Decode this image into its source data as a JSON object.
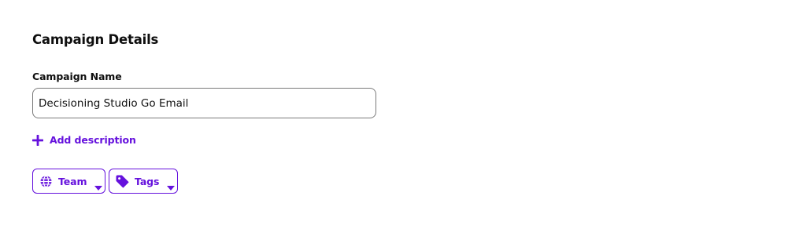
{
  "section": {
    "title": "Campaign Details"
  },
  "campaign_name": {
    "label": "Campaign Name",
    "value": "Decisioning Studio Go Email"
  },
  "add_description": {
    "label": "Add description",
    "icon": "plus-icon"
  },
  "filters": [
    {
      "label": "Team",
      "icon": "globe-icon"
    },
    {
      "label": "Tags",
      "icon": "tag-icon"
    }
  ],
  "colors": {
    "accent": "#6511dd",
    "input_border": "#7a7a7a",
    "text": "#111111",
    "background": "#ffffff"
  }
}
